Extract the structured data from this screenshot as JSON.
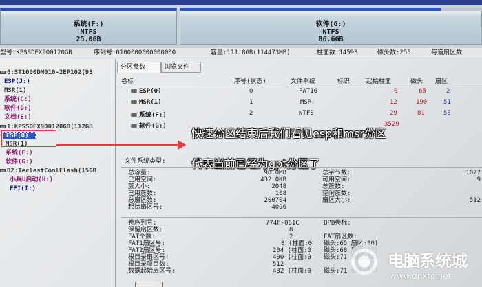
{
  "disk_map": {
    "system": {
      "name": "系统(F:)",
      "fs": "NTFS",
      "size": "25.0GB"
    },
    "software": {
      "name": "软件(G:)",
      "fs": "NTFS",
      "size": "86.6GB"
    }
  },
  "disk_info": {
    "model": "型号:KPSSDEX900120GB",
    "serial": "序列号:0100000000000000",
    "capacity": "容量:111.8GB(114473MB)",
    "cylinders": "柱面数:14593",
    "heads": "磁头数:255",
    "sectors_per_track": "每道扇区数"
  },
  "tree": {
    "disk0": "0:ST1000DM010-2EP102(93",
    "disk0_parts": [
      "ESP(J:)",
      "MSR(1)",
      "系统(C:)",
      "软件(D:)",
      "文档(E:)"
    ],
    "disk1": "1:KPSSDEX900120GB(112GB",
    "disk1_parts": [
      "ESP(0)",
      "MSR(1)",
      "系统(F:)",
      "软件(G:)"
    ],
    "disk2": "D2:TeclastCoolFlash(15GB",
    "disk2_parts": [
      "小兵U启动(H:)",
      "EFI(I:)"
    ]
  },
  "tabs": [
    "分区参数",
    "浏览文件"
  ],
  "partition_table": {
    "header_title": "卷标",
    "columns": [
      "序号(状态)",
      "文件系统",
      "标识",
      "起始柱面",
      "磁头",
      "扇区"
    ],
    "rows": [
      {
        "label": "ESP(0)",
        "index": "0",
        "fs": "FAT16",
        "flag": "",
        "start_cyl": "0",
        "head": "65",
        "sector": "2"
      },
      {
        "label": "MSR(1)",
        "index": "1",
        "fs": "MSR",
        "flag": "",
        "start_cyl": "12",
        "head": "190",
        "sector": "51"
      },
      {
        "label": "系统(F:)",
        "index": "2",
        "fs": "NTFS",
        "flag": "",
        "start_cyl": "29",
        "head": "81",
        "sector": "53"
      },
      {
        "label": "软件(G:)",
        "index": "3",
        "fs": "",
        "flag": "",
        "start_cyl": "3529",
        "head": "",
        "sector": ""
      }
    ]
  },
  "annotation": {
    "line1": "快速分区结束后我们看见esp和msr分区",
    "line2": "代表当前已经为gpt分区了"
  },
  "fs_section": {
    "title": "文件系统类型:",
    "left": [
      {
        "k": "总容量:",
        "v": "98.0MB"
      },
      {
        "k": "已用空间:",
        "v": "432.0KB"
      },
      {
        "k": "簇大小:",
        "v": "2048"
      },
      {
        "k": "已用簇数:",
        "v": "108"
      },
      {
        "k": "总扇区数:",
        "v": "200704"
      },
      {
        "k": "起始扇区号:",
        "v": "4096"
      }
    ],
    "right": [
      {
        "k": "总字节数:",
        "v": "1027"
      },
      {
        "k": "可用空间:",
        "v": "9"
      },
      {
        "k": "总簇数:",
        "v": ""
      },
      {
        "k": "空闲簇数:",
        "v": ""
      },
      {
        "k": "扇区大小:",
        "v": "512"
      }
    ]
  },
  "boot_section": {
    "left": [
      {
        "k": "卷序列号:",
        "v": "774F-061C"
      },
      {
        "k": "保留扇区数:",
        "v": "8"
      },
      {
        "k": "FAT个数:",
        "v": "2"
      },
      {
        "k": "FAT1扇区号:",
        "v": "8 (柱面:0"
      },
      {
        "k": "FAT2扇区号:",
        "v": "204 (柱面:0"
      },
      {
        "k": "根目录扇区号:",
        "v": "400 (柱面:0"
      },
      {
        "k": "根目录项目数:",
        "v": "512"
      },
      {
        "k": "数据起始扇区号:",
        "v": "432 (柱面:0"
      }
    ],
    "right": [
      "BPB卷标:",
      "",
      "FAT扇区数:",
      "磁头:65 扇区:10)",
      "磁头:68 扇区:17)",
      "磁头:71 扇区:24)",
      "",
      "磁头:71 扇区:56)"
    ]
  },
  "watermark": {
    "text": "电脑系统城",
    "url": "www.dnxtc.net"
  }
}
